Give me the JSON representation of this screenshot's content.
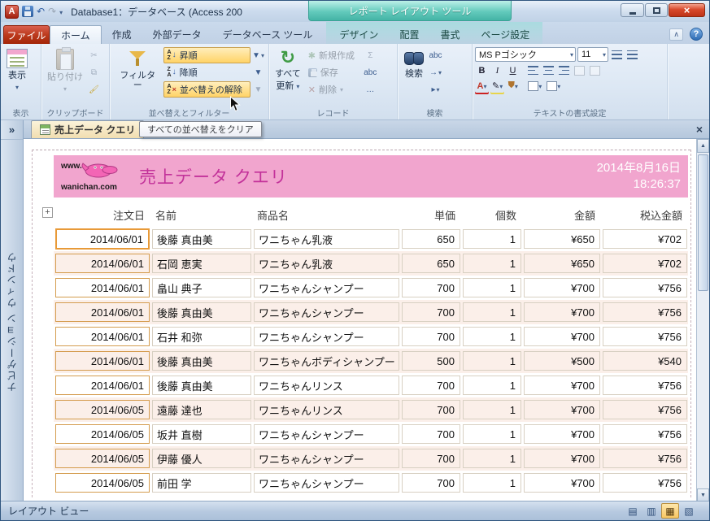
{
  "titlebar": {
    "app_initial": "A",
    "title": "Database1：データベース (Access 200",
    "contextual_tool": "レポート レイアウト ツール"
  },
  "ribbon": {
    "file_tab": "ファイル",
    "tabs": [
      "ホーム",
      "作成",
      "外部データ",
      "データベース ツール"
    ],
    "contextual_tabs": [
      "デザイン",
      "配置",
      "書式",
      "ページ設定"
    ],
    "view_group": {
      "label": "表示",
      "view": "表示"
    },
    "clipboard_group": {
      "label": "クリップボード",
      "paste": "貼り付け"
    },
    "sort_group": {
      "label": "並べ替えとフィルター",
      "filter": "フィルター",
      "ascending": "昇順",
      "descending": "降順",
      "clear_sort": "並べ替えの解除"
    },
    "records_group": {
      "label": "レコード",
      "refresh_line1": "すべて",
      "refresh_line2": "更新",
      "new": "新規作成",
      "save": "保存",
      "delete": "削除"
    },
    "find_group": {
      "label": "検索",
      "find": "検索"
    },
    "format_group": {
      "label": "テキストの書式設定",
      "font_name": "MS Pゴシック",
      "font_size": "11",
      "bold": "B",
      "italic": "I",
      "underline": "U",
      "color_letter": "A"
    }
  },
  "tooltip": "すべての並べ替えをクリア",
  "document_tab": "売上データ クエリ",
  "nav_pane_label": "ナビゲーション ウィンドウ",
  "report": {
    "logo_top": "www.",
    "logo_bottom": "wanichan.com",
    "title": "売上データ クエリ",
    "date": "2014年8月16日",
    "time": "18:26:37",
    "columns": [
      "注文日",
      "名前",
      "商品名",
      "単価",
      "個数",
      "金額",
      "税込金額"
    ],
    "rows": [
      [
        "2014/06/01",
        "後藤 真由美",
        "ワニちゃん乳液",
        "650",
        "1",
        "¥650",
        "¥702"
      ],
      [
        "2014/06/01",
        "石岡 恵実",
        "ワニちゃん乳液",
        "650",
        "1",
        "¥650",
        "¥702"
      ],
      [
        "2014/06/01",
        "畠山 典子",
        "ワニちゃんシャンプー",
        "700",
        "1",
        "¥700",
        "¥756"
      ],
      [
        "2014/06/01",
        "後藤 真由美",
        "ワニちゃんシャンプー",
        "700",
        "1",
        "¥700",
        "¥756"
      ],
      [
        "2014/06/01",
        "石井 和弥",
        "ワニちゃんシャンプー",
        "700",
        "1",
        "¥700",
        "¥756"
      ],
      [
        "2014/06/01",
        "後藤 真由美",
        "ワニちゃんボディシャンプー",
        "500",
        "1",
        "¥500",
        "¥540"
      ],
      [
        "2014/06/01",
        "後藤 真由美",
        "ワニちゃんリンス",
        "700",
        "1",
        "¥700",
        "¥756"
      ],
      [
        "2014/06/05",
        "遠藤 達也",
        "ワニちゃんリンス",
        "700",
        "1",
        "¥700",
        "¥756"
      ],
      [
        "2014/06/05",
        "坂井 直樹",
        "ワニちゃんシャンプー",
        "700",
        "1",
        "¥700",
        "¥756"
      ],
      [
        "2014/06/05",
        "伊藤 優人",
        "ワニちゃんシャンプー",
        "700",
        "1",
        "¥700",
        "¥756"
      ],
      [
        "2014/06/05",
        "前田 学",
        "ワニちゃんシャンプー",
        "700",
        "1",
        "¥700",
        "¥756"
      ]
    ]
  },
  "statusbar": {
    "view_label": "レイアウト ビュー"
  },
  "icons": {
    "undo": "↶",
    "redo": "↷",
    "chevrons": "»",
    "close": "×",
    "help": "?",
    "scroll_up": "▲",
    "scroll_down": "▼",
    "refresh": "↻",
    "sigma": "Σ",
    "spell": "abc",
    "ellipsis": "…",
    "goto": "→",
    "select_arrow": "▸",
    "view_report": "▤",
    "view_print": "▥",
    "view_layout": "▦",
    "view_design": "▧",
    "minimize_ribbon": "∧",
    "plus": "+",
    "scissors": "✂",
    "copy": "⧉"
  },
  "colors": {
    "header_pink": "#f1a5ce",
    "title_magenta": "#c3329a",
    "selection_orange": "#e89a38",
    "button_highlight": "#ffd367",
    "contextual_teal": "#44b4a6",
    "file_tab_red": "#bc3a1d"
  }
}
